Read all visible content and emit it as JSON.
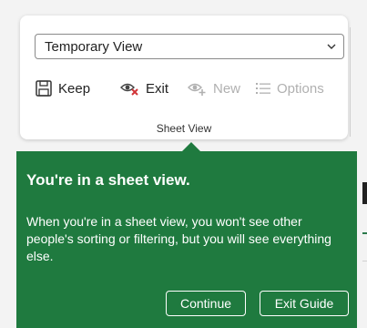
{
  "ribbon": {
    "view_select": {
      "value": "Temporary View"
    },
    "buttons": [
      {
        "label": "Keep",
        "icon": "save-icon",
        "enabled": true
      },
      {
        "label": "Exit",
        "icon": "exit-view-icon",
        "enabled": true
      },
      {
        "label": "New",
        "icon": "new-view-icon",
        "enabled": false
      },
      {
        "label": "Options",
        "icon": "options-list-icon",
        "enabled": false
      }
    ],
    "group_label": "Sheet View"
  },
  "callout": {
    "title": "You're in a sheet view.",
    "body": "When you're in a sheet view, you won't see other people's sorting or filtering, but you will see everything else.",
    "continue_label": "Continue",
    "exit_label": "Exit Guide"
  },
  "colors": {
    "callout_bg": "#1f7a3f",
    "exit_icon_accent": "#d13438"
  }
}
